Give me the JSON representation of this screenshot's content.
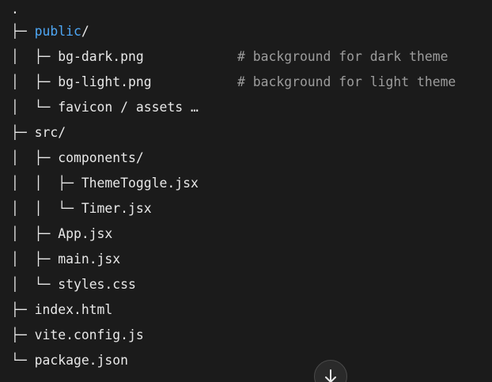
{
  "tree": {
    "root": ".",
    "lines": [
      {
        "prefix": "├─ ",
        "name": "public",
        "slash": "/",
        "comment": ""
      },
      {
        "prefix": "│  ├─ ",
        "name": "bg-dark.png",
        "slash": "",
        "comment": "# background for dark theme"
      },
      {
        "prefix": "│  ├─ ",
        "name": "bg-light.png",
        "slash": "",
        "comment": "# background for light theme"
      },
      {
        "prefix": "│  └─ ",
        "name": "favicon / assets …",
        "slash": "",
        "comment": ""
      },
      {
        "prefix": "├─ ",
        "name": "src/",
        "slash": "",
        "comment": ""
      },
      {
        "prefix": "│  ├─ ",
        "name": "components/",
        "slash": "",
        "comment": ""
      },
      {
        "prefix": "│  │  ├─ ",
        "name": "ThemeToggle.jsx",
        "slash": "",
        "comment": ""
      },
      {
        "prefix": "│  │  └─ ",
        "name": "Timer.jsx",
        "slash": "",
        "comment": ""
      },
      {
        "prefix": "│  ├─ ",
        "name": "App.jsx",
        "slash": "",
        "comment": ""
      },
      {
        "prefix": "│  ├─ ",
        "name": "main.jsx",
        "slash": "",
        "comment": ""
      },
      {
        "prefix": "│  └─ ",
        "name": "styles.css",
        "slash": "",
        "comment": ""
      },
      {
        "prefix": "├─ ",
        "name": "index.html",
        "slash": "",
        "comment": ""
      },
      {
        "prefix": "├─ ",
        "name": "vite.config.js",
        "slash": "",
        "comment": ""
      },
      {
        "prefix": "└─ ",
        "name": "package.json",
        "slash": "",
        "comment": ""
      }
    ]
  },
  "scroll_button": {
    "icon": "arrow-down-icon"
  },
  "colors": {
    "background": "#1b1b1b",
    "text": "#e8e8e8",
    "highlight": "#4ea7f5",
    "comment": "#9c9c9c"
  }
}
